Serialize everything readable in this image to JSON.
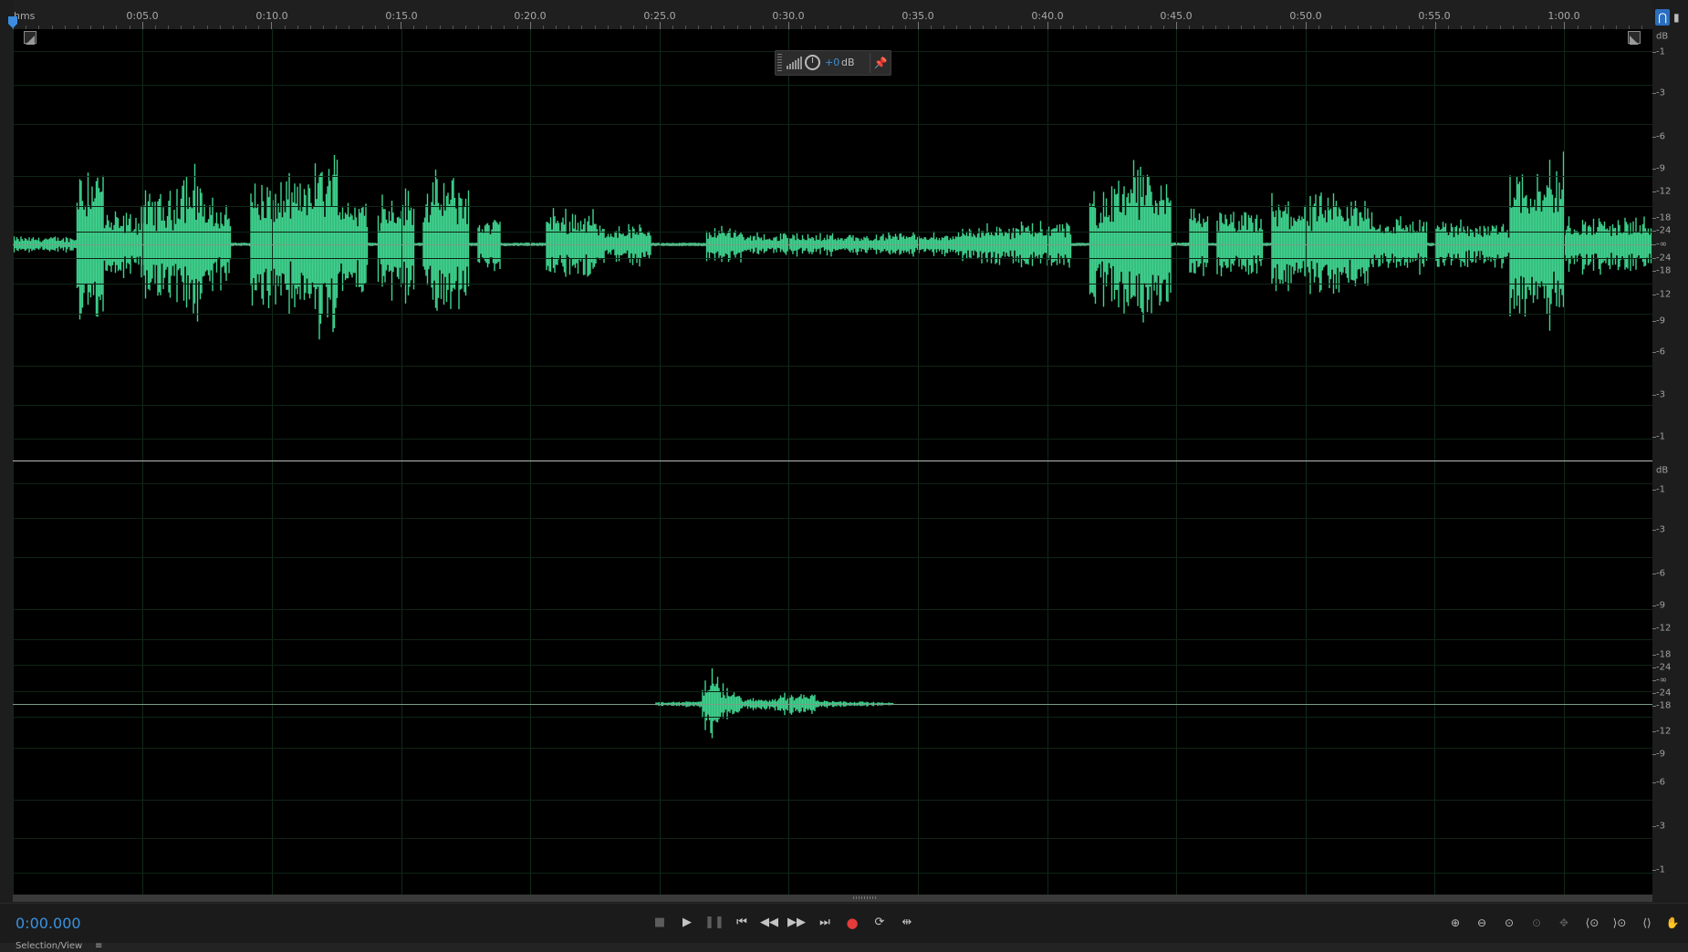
{
  "ruler": {
    "unit_label": "hms",
    "ticks": [
      "0:05.0",
      "0:10.0",
      "0:15.0",
      "0:20.0",
      "0:25.0",
      "0:30.0",
      "0:35.0",
      "0:40.0",
      "0:45.0",
      "0:50.0",
      "0:55.0",
      "1:00.0"
    ]
  },
  "hud": {
    "gain_value": "+0",
    "gain_unit": "dB"
  },
  "db_scale": {
    "unit": "dB",
    "labels": [
      "-1",
      "-3",
      "-6",
      "-9",
      "-12",
      "-18",
      "-24",
      "-∞",
      "-24",
      "-18",
      "-12",
      "-9",
      "-6",
      "-3",
      "-1"
    ]
  },
  "transport": {
    "current_time": "0:00.000",
    "buttons": [
      "stop",
      "play",
      "pause",
      "go-to-start",
      "rewind",
      "fast-forward",
      "go-to-end",
      "record",
      "loop",
      "skip-selection"
    ]
  },
  "zoom_controls": [
    "zoom-in-amplitude",
    "zoom-out-amplitude",
    "zoom-to-selection",
    "zoom-in-left",
    "zoom-in-right",
    "zoom-out-full",
    "zoom-in-time",
    "zoom-out-time",
    "zoom-full-time",
    "hand-tool"
  ],
  "bottom_panel": {
    "title": "Selection/View",
    "menu_icon": "≡"
  },
  "colors": {
    "waveform": "#3fd38e",
    "background": "#000000",
    "accent": "#3a93e0",
    "record": "#e53b3b"
  }
}
